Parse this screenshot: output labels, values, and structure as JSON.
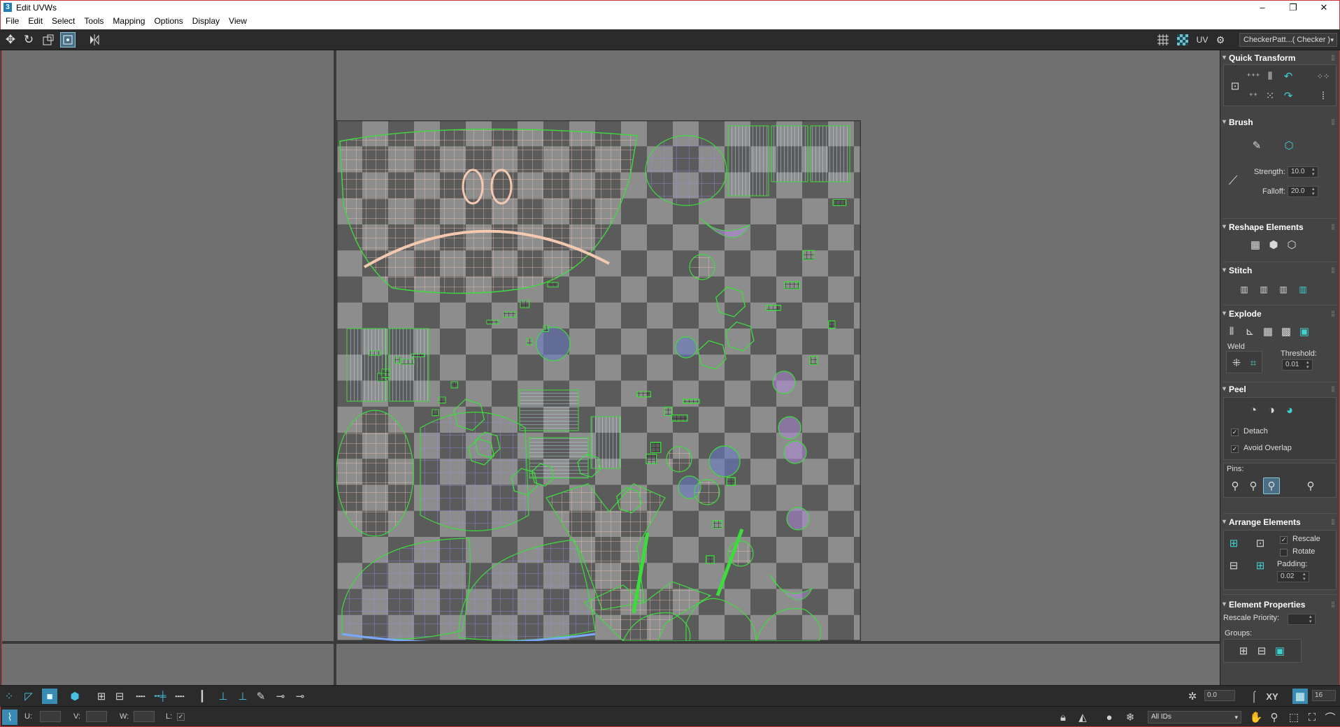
{
  "window": {
    "title": "Edit UVWs",
    "app_icon": "3",
    "minimize": "–",
    "restore": "❐",
    "close": "✕"
  },
  "menu": [
    "File",
    "Edit",
    "Select",
    "Tools",
    "Mapping",
    "Options",
    "Display",
    "View"
  ],
  "toolbar": {
    "tools": [
      "move-icon",
      "rotate-icon",
      "scale-icon",
      "freeform-icon",
      "mirror-icon"
    ],
    "right_tools": [
      "grid-icon",
      "checker-icon"
    ],
    "uv_label": "UV",
    "texture_select": "CheckerPatt...( Checker )"
  },
  "panel": {
    "quick_transform": {
      "title": "Quick Transform"
    },
    "brush": {
      "title": "Brush",
      "strength_label": "Strength:",
      "strength_value": "10.0",
      "falloff_label": "Falloff:",
      "falloff_value": "20.0"
    },
    "reshape": {
      "title": "Reshape Elements"
    },
    "stitch": {
      "title": "Stitch"
    },
    "explode": {
      "title": "Explode",
      "weld_label": "Weld",
      "threshold_label": "Threshold:",
      "threshold_value": "0.01"
    },
    "peel": {
      "title": "Peel",
      "detach_label": "Detach",
      "detach_checked": true,
      "avoid_overlap_label": "Avoid Overlap",
      "avoid_overlap_checked": true,
      "pins_label": "Pins:"
    },
    "arrange": {
      "title": "Arrange Elements",
      "rescale_label": "Rescale",
      "rescale_checked": true,
      "rotate_label": "Rotate",
      "rotate_checked": false,
      "padding_label": "Padding:",
      "padding_value": "0.02"
    },
    "element_properties": {
      "title": "Element Properties",
      "rescale_priority_label": "Rescale Priority:",
      "rescale_priority_value": "",
      "groups_label": "Groups:"
    }
  },
  "bottom": {
    "angle_value": "0.0",
    "xy_label": "XY",
    "grid_value": "16",
    "u_label": "U:",
    "u_value": "",
    "v_label": "V:",
    "v_value": "",
    "w_label": "W:",
    "w_value": "",
    "l_label": "L:",
    "ids_select": "All IDs"
  },
  "colors": {
    "accent": "#4a6f85",
    "uv_green": "#3ddc3d",
    "checker_dark": "#5b5b5b",
    "checker_light": "#8d8d8d",
    "viewport": "#707070"
  }
}
